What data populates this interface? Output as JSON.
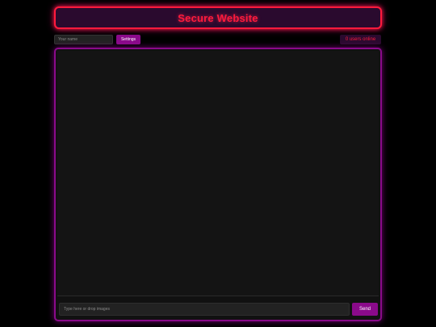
{
  "header": {
    "title": "Secure Website"
  },
  "controls": {
    "name_placeholder": "Your name",
    "name_value": "",
    "settings_label": "Settings",
    "users_online": "0 users online"
  },
  "chat": {
    "input_placeholder": "Type here or drop images",
    "send_label": "Send"
  },
  "colors": {
    "accent_red": "#ff1a3c",
    "accent_purple": "#8a0a8a",
    "background": "#000000",
    "panel": "#141414"
  }
}
